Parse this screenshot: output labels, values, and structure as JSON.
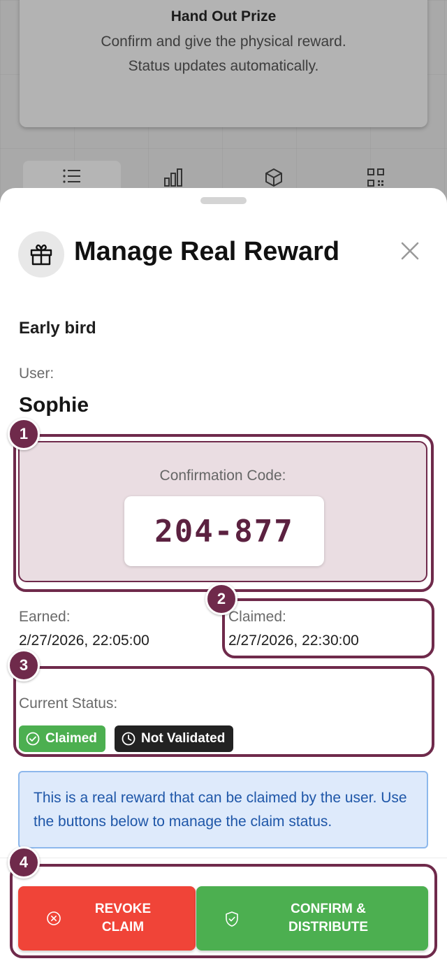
{
  "background": {
    "card_title": "Hand Out Prize",
    "card_subtitle_line1": "Confirm and give the physical reward.",
    "card_subtitle_line2": "Status updates automatically.",
    "tabs": [
      {
        "icon": "list-icon"
      },
      {
        "icon": "bar-chart-icon"
      },
      {
        "icon": "box-icon"
      },
      {
        "icon": "qr-code-icon"
      }
    ]
  },
  "sheet": {
    "title": "Manage Real Reward",
    "header_icon": "gift-icon",
    "close_icon": "close-icon",
    "reward_name": "Early bird",
    "user_label": "User:",
    "user_name": "Sophie",
    "confirmation": {
      "label": "Confirmation Code:",
      "code": "204-877"
    },
    "earned": {
      "label": "Earned:",
      "value": "2/27/2026, 22:05:00"
    },
    "claimed": {
      "label": "Claimed:",
      "value": "2/27/2026, 22:30:00"
    },
    "status": {
      "label": "Current Status:",
      "badges": [
        {
          "text": "Claimed",
          "color": "#4caf50",
          "icon": "check-circle-icon"
        },
        {
          "text": "Not Validated",
          "color": "#222222",
          "icon": "clock-icon"
        }
      ]
    },
    "info_text": "This is a real reward that can be claimed by the user. Use the buttons below to manage the claim status.",
    "buttons": {
      "revoke": {
        "line1": "REVOKE",
        "line2": "CLAIM",
        "color": "#f04438",
        "icon": "x-circle-icon"
      },
      "confirm": {
        "line1": "CONFIRM &",
        "line2": "DISTRIBUTE",
        "color": "#4caf50",
        "icon": "shield-check-icon"
      }
    }
  },
  "tutorial_markers": [
    "1",
    "2",
    "3",
    "4"
  ],
  "colors": {
    "accent": "#6f2a4b"
  }
}
